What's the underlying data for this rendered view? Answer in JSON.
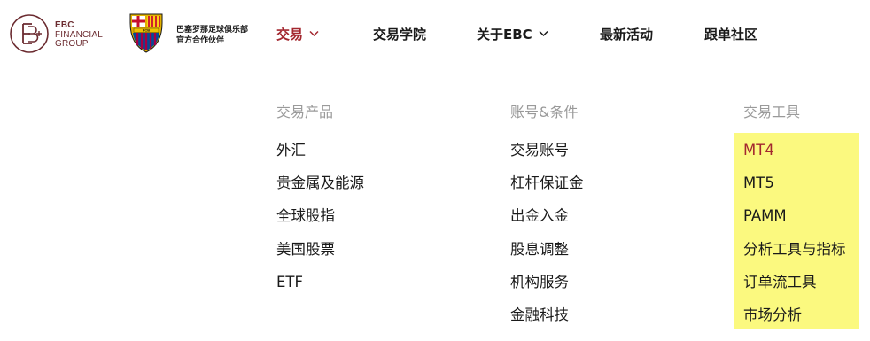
{
  "brand": {
    "abbr": "EBC",
    "line1": "EBC",
    "line2": "FINANCIAL",
    "line3": "GROUP",
    "color": "#6b2b30",
    "partner_line1": "巴塞罗那足球俱乐部",
    "partner_line2": "官方合作伙伴",
    "crest_letters": "FCB"
  },
  "nav": {
    "trade": "交易",
    "academy": "交易学院",
    "about": "关于EBC",
    "events": "最新活动",
    "community": "跟单社区",
    "active_color": "#a3272f"
  },
  "dropdown": {
    "columns": [
      {
        "heading": "交易产品",
        "items": [
          "外汇",
          "贵金属及能源",
          "全球股指",
          "美国股票",
          "ETF"
        ]
      },
      {
        "heading": "账号&条件",
        "items": [
          "交易账号",
          "杠杆保证金",
          "出金入金",
          "股息调整",
          "机构服务",
          "金融科技"
        ]
      },
      {
        "heading": "交易工具",
        "items": [
          "MT4",
          "MT5",
          "PAMM",
          "分析工具与指标",
          "订单流工具",
          "市场分析"
        ]
      }
    ],
    "highlight_color": "#fbf97f"
  }
}
